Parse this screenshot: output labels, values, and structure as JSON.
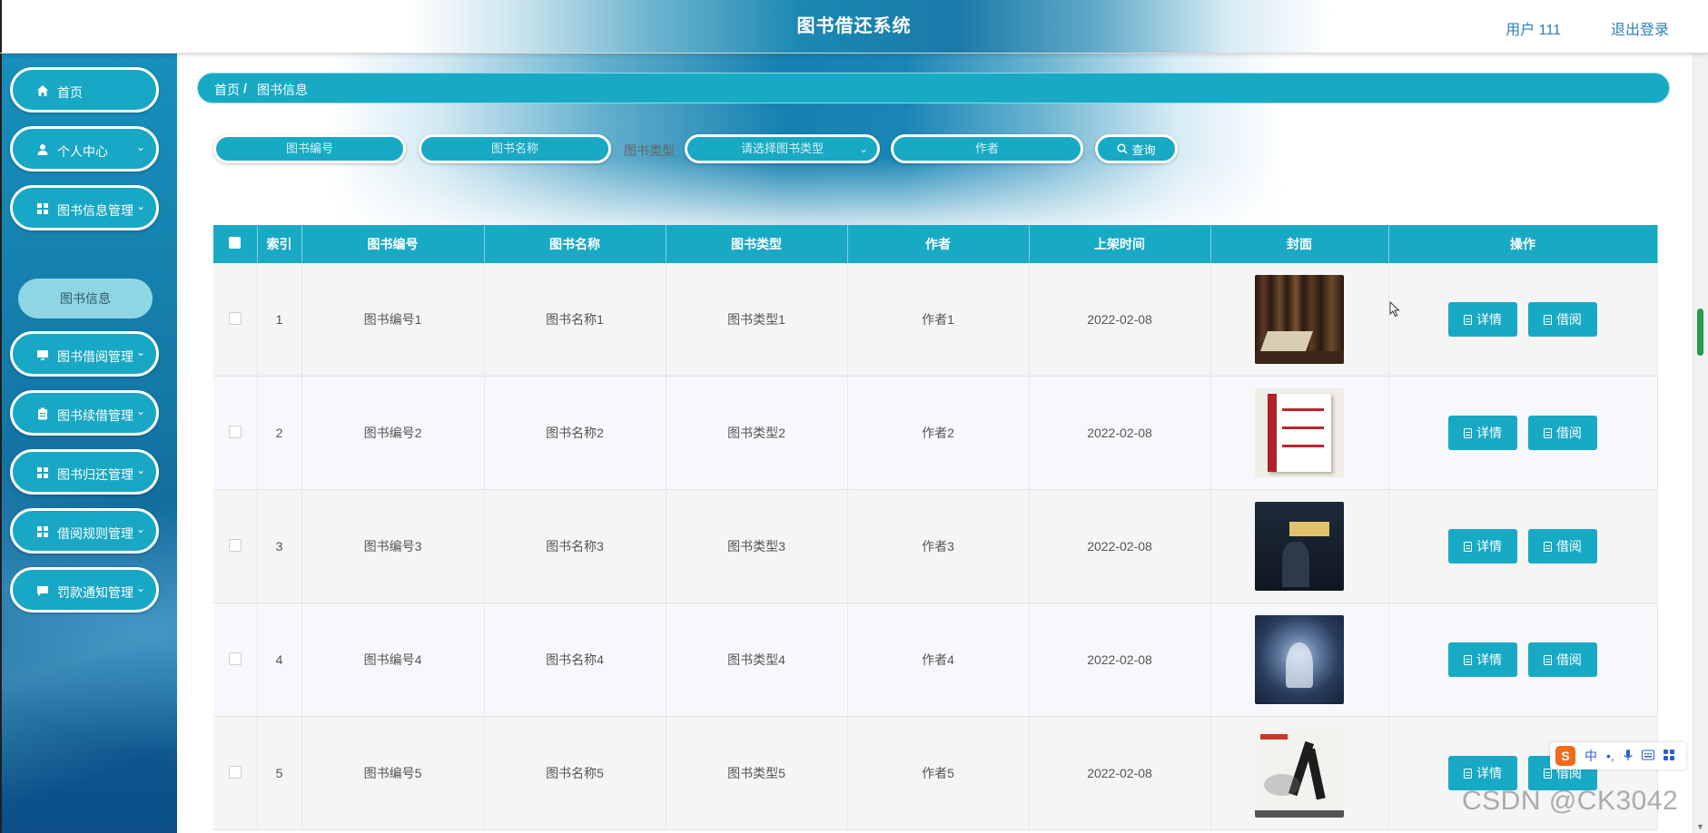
{
  "header": {
    "title": "图书借还系统",
    "user": "用户 111",
    "logout": "退出登录"
  },
  "sidebar": {
    "items": [
      {
        "label": "首页",
        "icon": "home-icon",
        "has_children": false
      },
      {
        "label": "个人中心",
        "icon": "person-icon",
        "has_children": true
      },
      {
        "label": "图书信息管理",
        "icon": "grid-icon",
        "has_children": true
      },
      {
        "label": "图书借阅管理",
        "icon": "monitor-icon",
        "has_children": true
      },
      {
        "label": "图书续借管理",
        "icon": "clipboard-icon",
        "has_children": true
      },
      {
        "label": "图书归还管理",
        "icon": "grid-icon",
        "has_children": true
      },
      {
        "label": "借阅规则管理",
        "icon": "grid-icon",
        "has_children": true
      },
      {
        "label": "罚款通知管理",
        "icon": "message-icon",
        "has_children": true
      }
    ],
    "submenu": {
      "label": "图书信息"
    }
  },
  "breadcrumb": {
    "home": "首页",
    "separator": "/",
    "current": "图书信息"
  },
  "search": {
    "book_no_placeholder": "图书编号",
    "book_name_placeholder": "图书名称",
    "type_label": "图书类型",
    "type_placeholder": "请选择图书类型",
    "author_placeholder": "作者",
    "query_label": "查询"
  },
  "table": {
    "headers": [
      "索引",
      "图书编号",
      "图书名称",
      "图书类型",
      "作者",
      "上架时间",
      "封面",
      "操作"
    ],
    "rows": [
      {
        "index": "1",
        "book_no": "图书编号1",
        "name": "图书名称1",
        "type": "图书类型1",
        "author": "作者1",
        "date": "2022-02-08"
      },
      {
        "index": "2",
        "book_no": "图书编号2",
        "name": "图书名称2",
        "type": "图书类型2",
        "author": "作者2",
        "date": "2022-02-08"
      },
      {
        "index": "3",
        "book_no": "图书编号3",
        "name": "图书名称3",
        "type": "图书类型3",
        "author": "作者3",
        "date": "2022-02-08"
      },
      {
        "index": "4",
        "book_no": "图书编号4",
        "name": "图书名称4",
        "type": "图书类型4",
        "author": "作者4",
        "date": "2022-02-08"
      },
      {
        "index": "5",
        "book_no": "图书编号5",
        "name": "图书名称5",
        "type": "图书类型5",
        "author": "作者5",
        "date": "2022-02-08"
      }
    ],
    "actions": {
      "detail": "详情",
      "borrow": "借阅"
    }
  },
  "ime": {
    "label": "中"
  },
  "watermark": "CSDN @CK3042",
  "colors": {
    "accent": "#18a9c5",
    "header_blue": "#1a7aa8",
    "sidebar_blue": "#1478a8",
    "link": "#2e7fb5"
  }
}
